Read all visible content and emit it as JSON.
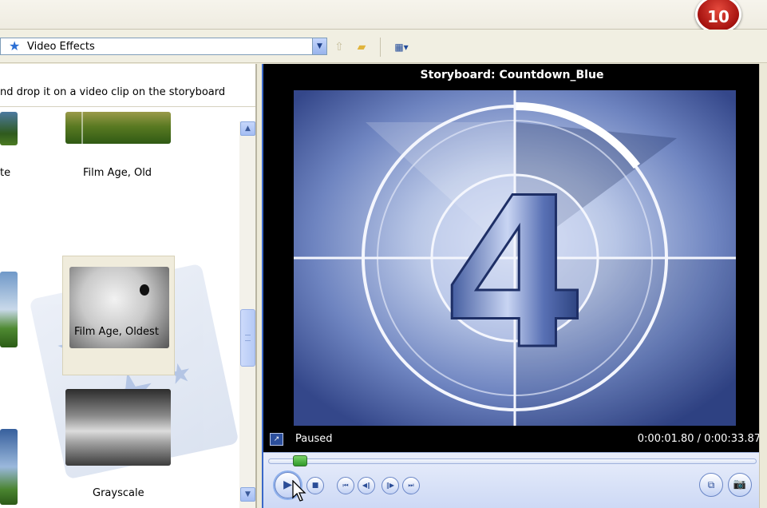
{
  "badge": {
    "number": "10"
  },
  "toolbar": {
    "collection": "Video Effects",
    "icons": {
      "collection": "star-icon",
      "up": "up-folder-icon",
      "new_folder": "new-folder-icon",
      "views": "views-icon"
    }
  },
  "effects_pane": {
    "instruction": "nd drop it on a video clip on the storyboard",
    "items": [
      {
        "label": "te"
      },
      {
        "label": "Film Age, Old"
      },
      {
        "label": "Film Age, Oldest",
        "selected": true
      },
      {
        "label": "Grayscale"
      }
    ]
  },
  "monitor": {
    "title": "Storyboard: Countdown_Blue",
    "status": "Paused",
    "time": "0:00:01.80 / 0:00:33.87",
    "countdown_number": "4",
    "seek_fraction": 0.053
  },
  "colors": {
    "accent": "#3a68c8",
    "badge": "#b0140f",
    "seek_thumb": "#3aa336"
  }
}
